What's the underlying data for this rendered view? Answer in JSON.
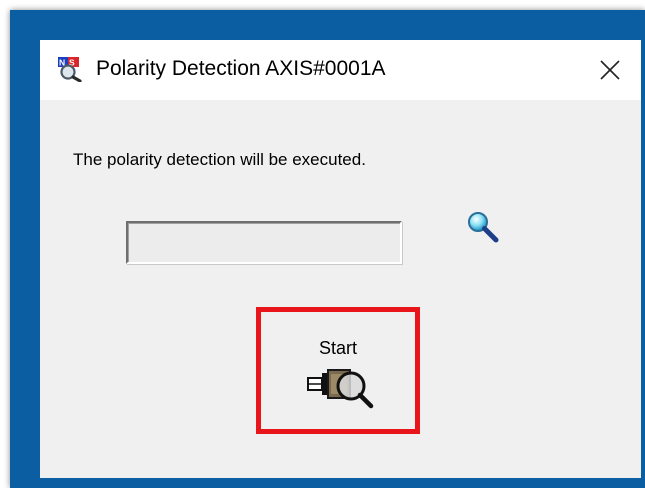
{
  "window": {
    "title": "Polarity Detection AXIS#0001A",
    "app_icon": "nis-magnifier-icon",
    "close_icon": "close-icon"
  },
  "content": {
    "message": "The polarity detection will be executed.",
    "progress": 0,
    "status_icon": "magnifier-icon",
    "start_button": {
      "label": "Start",
      "icon": "motor-detect-icon"
    }
  },
  "colors": {
    "desktop_frame": "#0a5ea1",
    "window_bg": "#f0f0f0",
    "titlebar_bg": "#ffffff",
    "highlight": "#e8151b"
  }
}
